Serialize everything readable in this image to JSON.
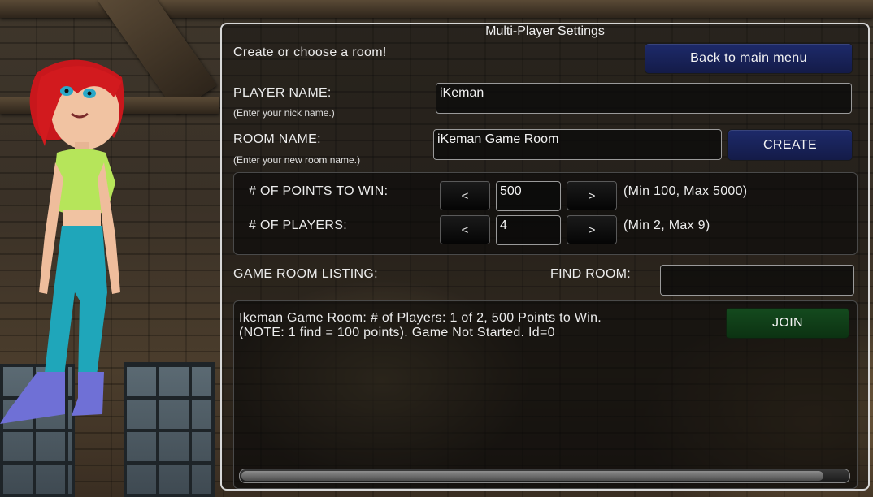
{
  "panel": {
    "title": "Multi-Player Settings",
    "intro": "Create or choose a room!",
    "back_button": "Back to main menu"
  },
  "player": {
    "label": "PLAYER NAME:",
    "hint": "(Enter your nick name.)",
    "value": "iKeman"
  },
  "room": {
    "label": "ROOM NAME:",
    "hint": "(Enter your new room name.)",
    "value": "iKeman Game Room",
    "create_button": "CREATE"
  },
  "settings": {
    "points": {
      "label": "# OF POINTS TO WIN:",
      "decrement": "<",
      "value": "500",
      "increment": ">",
      "range": "(Min 100, Max 5000)"
    },
    "players": {
      "label": "# OF PLAYERS:",
      "decrement": "<",
      "value": "4",
      "increment": ">",
      "range": "(Min 2, Max 9)"
    }
  },
  "listing": {
    "label": "GAME ROOM LISTING:",
    "find_label": "FIND ROOM:",
    "find_value": "",
    "rooms": [
      {
        "line1": "Ikeman Game Room: # of Players: 1 of 2, 500 Points to Win.",
        "line2": "(NOTE: 1 find = 100 points). Game Not Started. Id=0",
        "join_button": "JOIN"
      }
    ],
    "scroll_position": 0.96
  },
  "colors": {
    "blue_button": "#1d2a6a",
    "green_button": "#144a1e",
    "panel_border": "#d8d8d8"
  }
}
